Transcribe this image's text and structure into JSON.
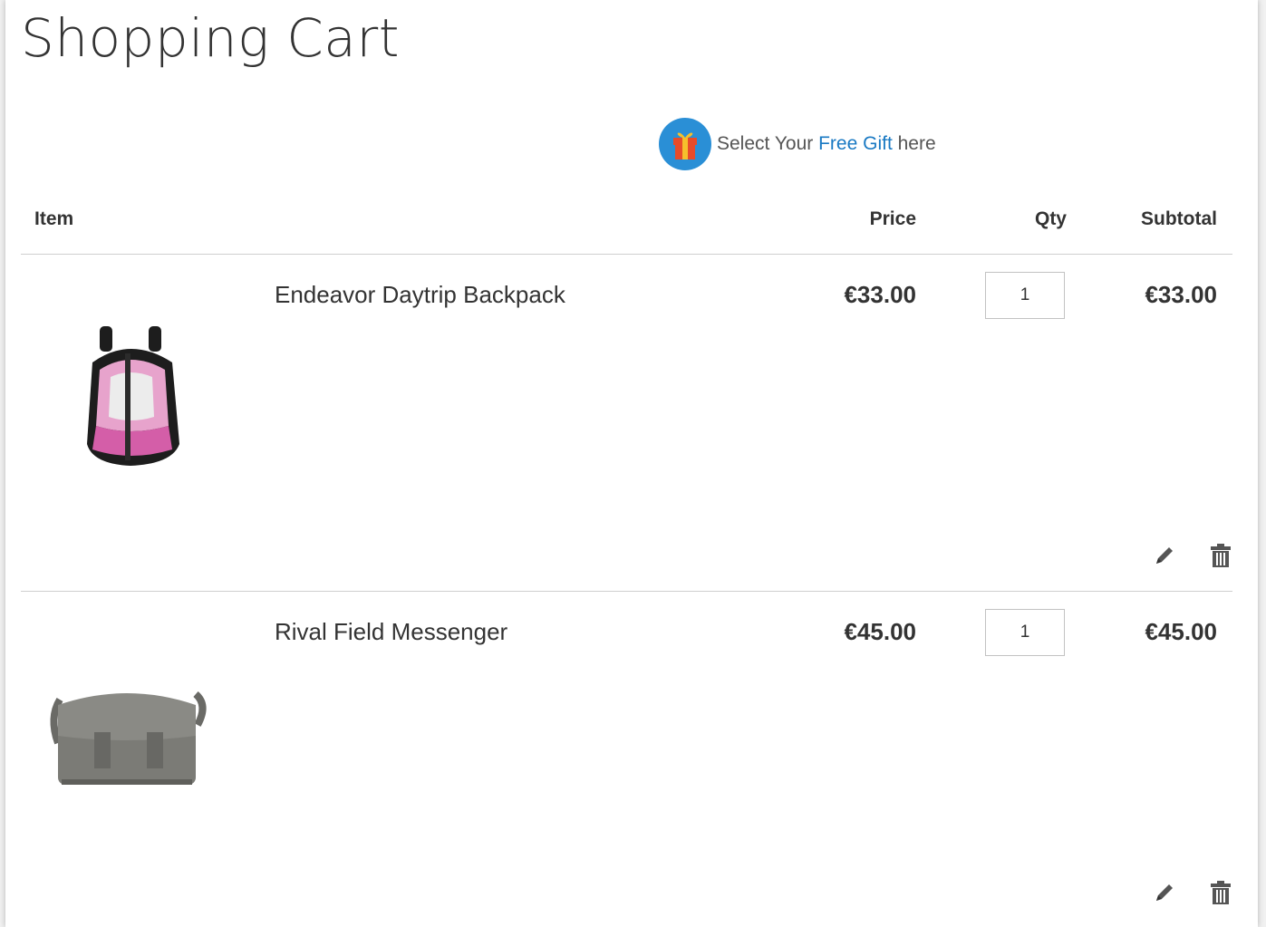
{
  "page": {
    "title": "Shopping Cart"
  },
  "gift": {
    "prefix": "Select Your ",
    "link": "Free Gift",
    "suffix": " here"
  },
  "table": {
    "headers": {
      "item": "Item",
      "price": "Price",
      "qty": "Qty",
      "subtotal": "Subtotal"
    }
  },
  "items": [
    {
      "name": "Endeavor Daytrip Backpack",
      "price": "€33.00",
      "qty": "1",
      "subtotal": "€33.00",
      "image_icon": "backpack-image"
    },
    {
      "name": "Rival Field Messenger",
      "price": "€45.00",
      "qty": "1",
      "subtotal": "€45.00",
      "image_icon": "messenger-bag-image"
    }
  ],
  "colors": {
    "accent": "#1979c3",
    "gift_circle": "#2a8fd6"
  }
}
